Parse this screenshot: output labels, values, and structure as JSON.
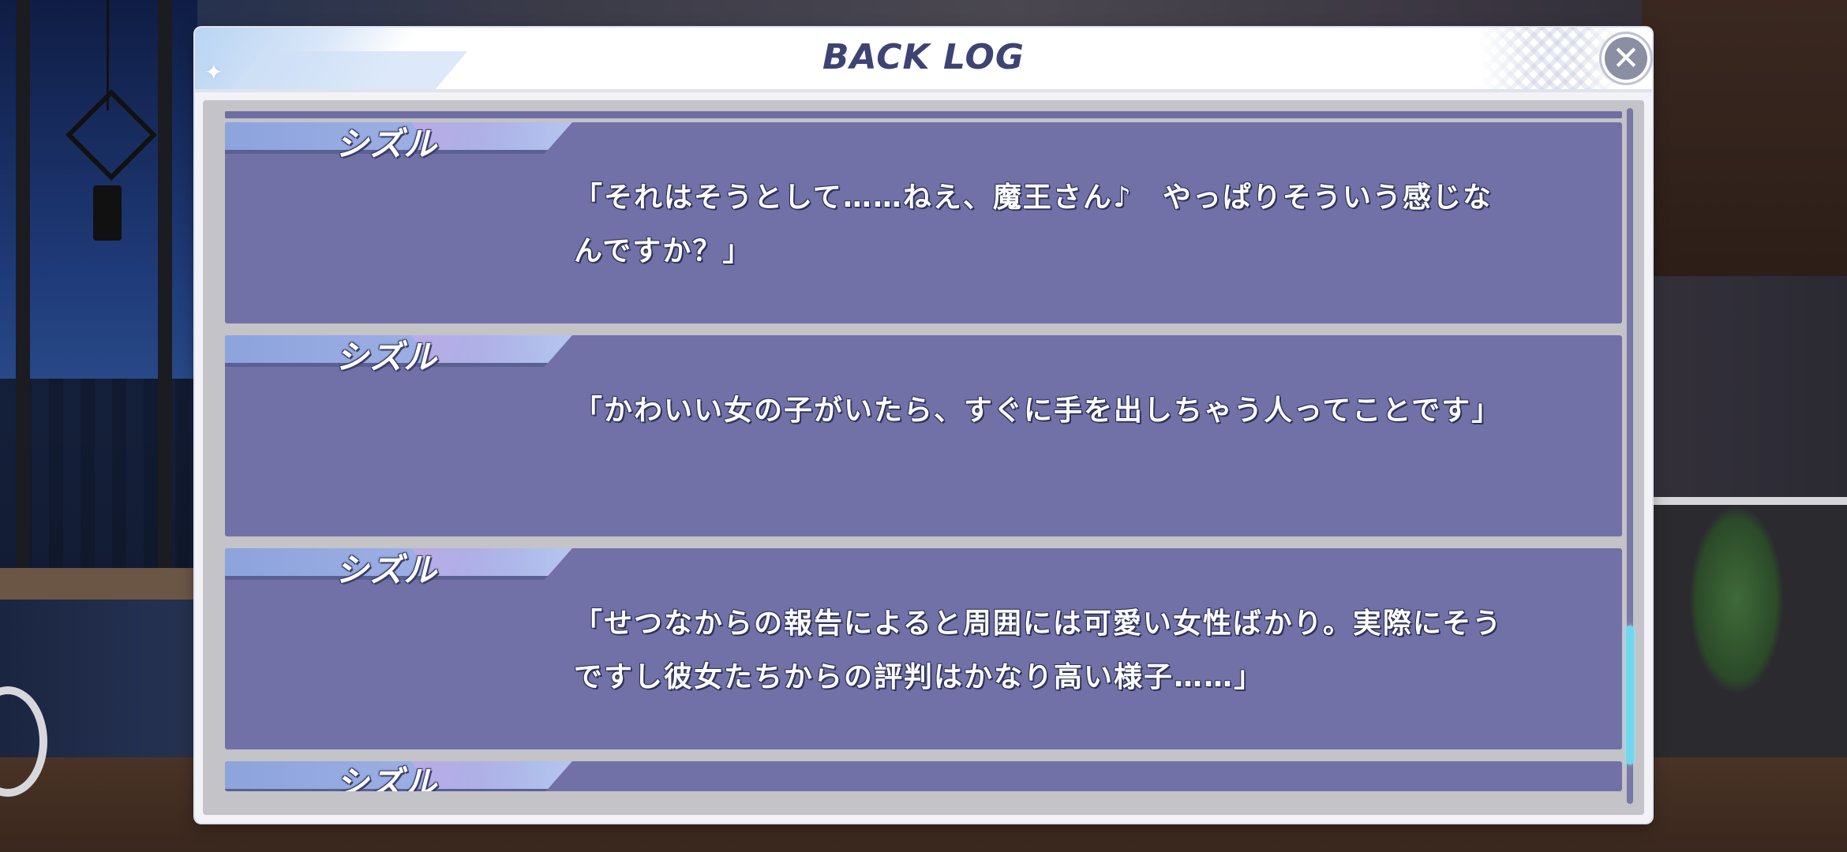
{
  "dialog": {
    "title": "BACK LOG",
    "close_label": "✕"
  },
  "log": {
    "entries": [
      {
        "speaker": "シズル",
        "text": "「それはそうとして……ねえ、魔王さん♪　やっぱりそういう感じなんですか？」"
      },
      {
        "speaker": "シズル",
        "text": "「かわいい女の子がいたら、すぐに手を出しちゃう人ってことです」"
      },
      {
        "speaker": "シズル",
        "text": "「せつなからの報告によると周囲には可愛い女性ばかり。実際にそうですし彼女たちからの評判はかなり高い様子……」"
      },
      {
        "speaker": "シズル",
        "text": ""
      }
    ]
  },
  "scrollbar": {
    "position_fraction": 0.85,
    "thumb_color": "#6fd8f0"
  },
  "colors": {
    "entry_bg": "#7171a8",
    "title_text": "#3d4473",
    "name_tab": "#9fb2e6"
  }
}
